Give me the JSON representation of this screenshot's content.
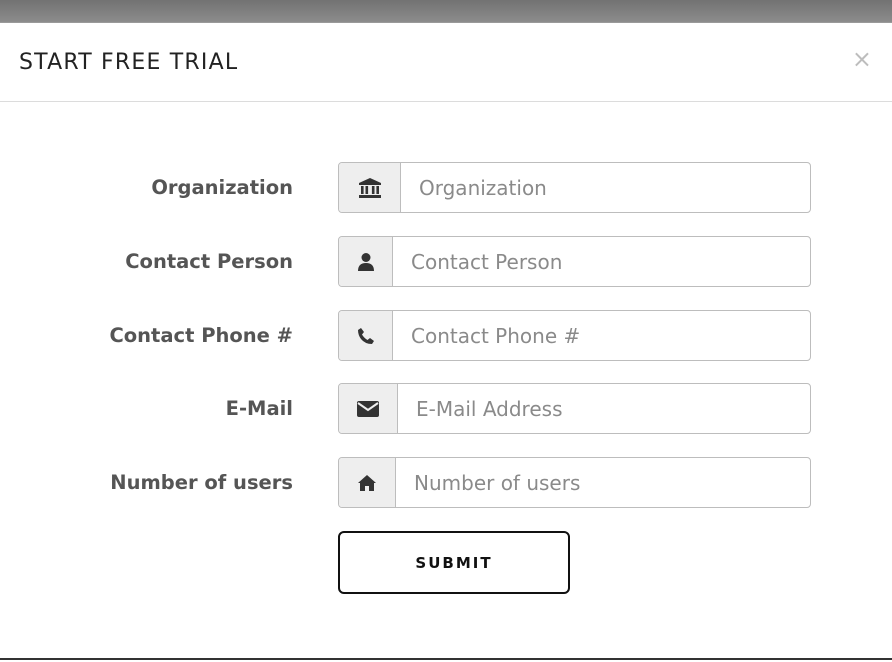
{
  "modal": {
    "title": "START FREE TRIAL",
    "close_label": "×"
  },
  "form": {
    "fields": [
      {
        "label": "Organization",
        "placeholder": "Organization",
        "value": "",
        "icon": "bank-icon"
      },
      {
        "label": "Contact Person",
        "placeholder": "Contact Person",
        "value": "",
        "icon": "user-icon"
      },
      {
        "label": "Contact Phone #",
        "placeholder": "Contact Phone #",
        "value": "",
        "icon": "phone-icon"
      },
      {
        "label": "E-Mail",
        "placeholder": "E-Mail Address",
        "value": "",
        "icon": "envelope-icon"
      },
      {
        "label": "Number of users",
        "placeholder": "Number of users",
        "value": "",
        "icon": "home-icon"
      }
    ],
    "submit_label": "SUBMIT"
  }
}
